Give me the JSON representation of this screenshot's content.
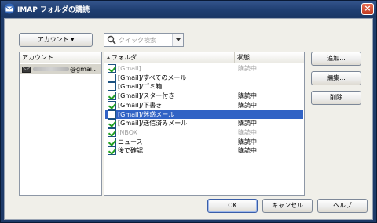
{
  "window": {
    "title": "IMAP フォルダの購読",
    "close_label": "×"
  },
  "toolbar": {
    "account_button": "アカウント ▾",
    "search_placeholder": "クイック検索"
  },
  "accounts": {
    "header": "アカウント",
    "items": [
      {
        "label": "@gmai..."
      }
    ]
  },
  "folders": {
    "columns": {
      "name": "フォルダ",
      "status": "状態"
    },
    "rows": [
      {
        "name": "[Gmail]",
        "status": "購読中",
        "checked": true,
        "dim": true,
        "selected": false
      },
      {
        "name": "[Gmail]/すべてのメール",
        "status": "",
        "checked": false,
        "dim": false,
        "selected": false
      },
      {
        "name": "[Gmail]/ゴミ箱",
        "status": "",
        "checked": false,
        "dim": false,
        "selected": false
      },
      {
        "name": "[Gmail]/スター付き",
        "status": "購読中",
        "checked": true,
        "dim": false,
        "selected": false
      },
      {
        "name": "[Gmail]/下書き",
        "status": "購読中",
        "checked": true,
        "dim": false,
        "selected": false
      },
      {
        "name": "[Gmail]/迷惑メール",
        "status": "",
        "checked": false,
        "dim": false,
        "selected": true
      },
      {
        "name": "[Gmail]/送信済みメール",
        "status": "購読中",
        "checked": true,
        "dim": false,
        "selected": false
      },
      {
        "name": "INBOX",
        "status": "購読中",
        "checked": true,
        "dim": true,
        "selected": false
      },
      {
        "name": "ニュース",
        "status": "購読中",
        "checked": true,
        "dim": false,
        "selected": false
      },
      {
        "name": "後で確認",
        "status": "購読中",
        "checked": true,
        "dim": false,
        "selected": false
      }
    ]
  },
  "actions": {
    "add": "追加...",
    "edit": "編集...",
    "delete": "削除"
  },
  "footer": {
    "ok": "OK",
    "cancel": "キャンセル",
    "help": "ヘルプ"
  }
}
